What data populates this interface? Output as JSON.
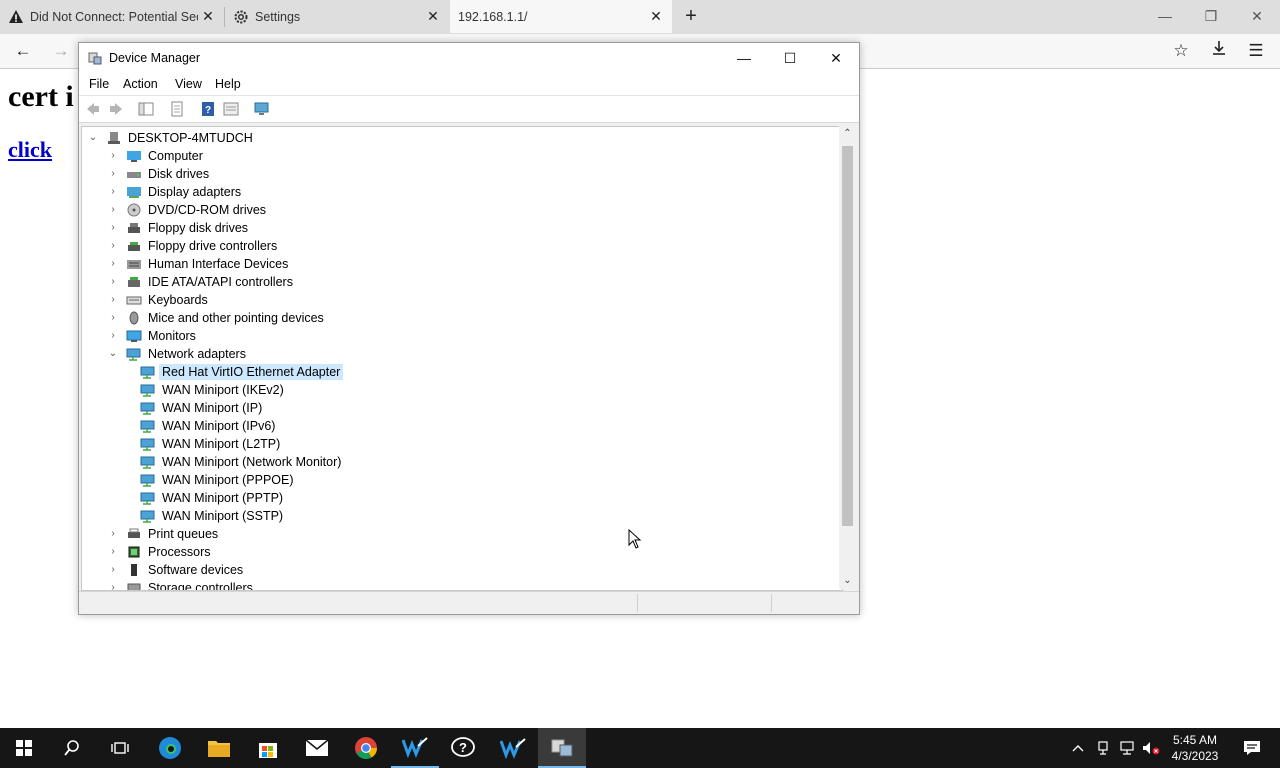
{
  "browser": {
    "tabs": [
      {
        "label": "Did Not Connect: Potential Securi",
        "icon": "warning-icon"
      },
      {
        "label": "Settings",
        "icon": "gear-icon"
      },
      {
        "label": "192.168.1.1/",
        "icon": "none"
      }
    ]
  },
  "page": {
    "heading": "cert i",
    "link": "click"
  },
  "device_manager": {
    "title": "Device Manager",
    "menu": [
      "File",
      "Action",
      "View",
      "Help"
    ],
    "root": "DESKTOP-4MTUDCH",
    "categories": [
      {
        "label": "Computer",
        "icon": "computer-icon"
      },
      {
        "label": "Disk drives",
        "icon": "disk-drive-icon"
      },
      {
        "label": "Display adapters",
        "icon": "display-adapter-icon"
      },
      {
        "label": "DVD/CD-ROM drives",
        "icon": "dvd-icon"
      },
      {
        "label": "Floppy disk drives",
        "icon": "floppy-icon"
      },
      {
        "label": "Floppy drive controllers",
        "icon": "controller-icon"
      },
      {
        "label": "Human Interface Devices",
        "icon": "hid-icon"
      },
      {
        "label": "IDE ATA/ATAPI controllers",
        "icon": "ide-icon"
      },
      {
        "label": "Keyboards",
        "icon": "keyboard-icon"
      },
      {
        "label": "Mice and other pointing devices",
        "icon": "mouse-icon"
      },
      {
        "label": "Monitors",
        "icon": "monitor-icon"
      },
      {
        "label": "Network adapters",
        "icon": "network-adapter-icon",
        "expanded": true
      }
    ],
    "network_adapters": [
      {
        "label": "Red Hat VirtIO Ethernet Adapter",
        "selected": true
      },
      {
        "label": "WAN Miniport (IKEv2)"
      },
      {
        "label": "WAN Miniport (IP)"
      },
      {
        "label": "WAN Miniport (IPv6)"
      },
      {
        "label": "WAN Miniport (L2TP)"
      },
      {
        "label": "WAN Miniport (Network Monitor)"
      },
      {
        "label": "WAN Miniport (PPPOE)"
      },
      {
        "label": "WAN Miniport (PPTP)"
      },
      {
        "label": "WAN Miniport (SSTP)"
      }
    ],
    "categories_after": [
      {
        "label": "Print queues",
        "icon": "printer-icon"
      },
      {
        "label": "Processors",
        "icon": "processor-icon"
      },
      {
        "label": "Software devices",
        "icon": "software-device-icon"
      },
      {
        "label": "Storage controllers",
        "icon": "storage-icon"
      }
    ]
  },
  "taskbar": {
    "clock_time": "5:45 AM",
    "clock_date": "4/3/2023",
    "apps": [
      "start-icon",
      "search-icon",
      "task-view-icon",
      "edge-icon",
      "file-explorer-icon",
      "store-icon",
      "mail-icon",
      "chrome-icon",
      "app-icon",
      "help-icon",
      "app-icon",
      "device-manager-icon"
    ]
  }
}
